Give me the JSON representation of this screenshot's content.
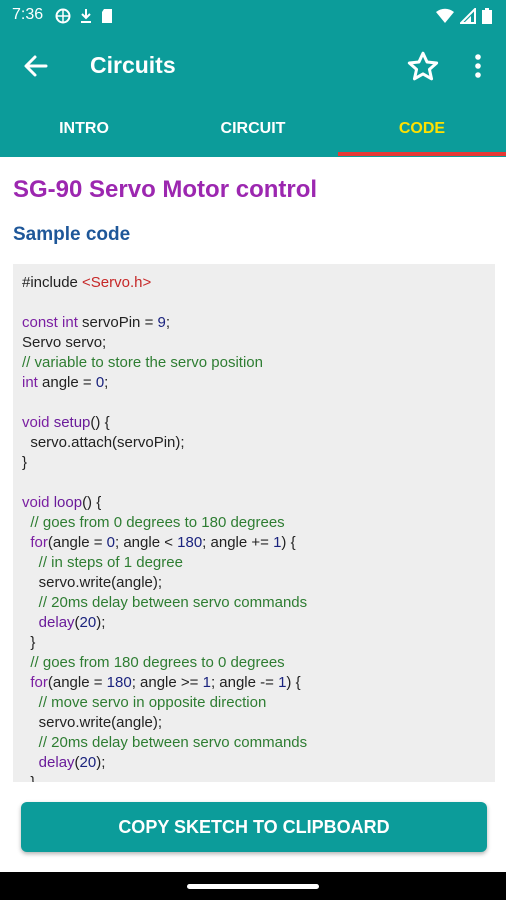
{
  "status_bar": {
    "time": "7:36"
  },
  "app_bar": {
    "title": "Circuits"
  },
  "tabs": [
    {
      "label": "INTRO",
      "active": false
    },
    {
      "label": "CIRCUIT",
      "active": false
    },
    {
      "label": "CODE",
      "active": true
    }
  ],
  "content": {
    "title": "SG-90 Servo Motor control",
    "subtitle": "Sample code",
    "code_lines": [
      "#include <Servo.h>",
      "",
      "const int servoPin = 9;",
      "Servo servo;",
      "// variable to store the servo position",
      "int angle = 0;",
      "",
      "void setup() {",
      "  servo.attach(servoPin);",
      "}",
      "",
      "void loop() {",
      "  // goes from 0 degrees to 180 degrees",
      "  for(angle = 0; angle < 180; angle += 1) {",
      "    // in steps of 1 degree",
      "    servo.write(angle);",
      "    // 20ms delay between servo commands",
      "    delay(20);",
      "  }",
      "  // goes from 180 degrees to 0 degrees",
      "  for(angle = 180; angle >= 1; angle -= 1) {",
      "    // move servo in opposite direction",
      "    servo.write(angle);",
      "    // 20ms delay between servo commands",
      "    delay(20);",
      "  }"
    ]
  },
  "button": {
    "label": "COPY SKETCH TO CLIPBOARD"
  },
  "colors": {
    "primary": "#0c9c9a",
    "tab_active": "#ffe100",
    "indicator": "#e53935",
    "title": "#9c27b0",
    "subtitle": "#1e5799"
  },
  "icons": [
    "arrow-back-icon",
    "star-outline-icon",
    "more-vert-icon",
    "vpn-icon",
    "download-icon",
    "sd-card-icon",
    "wifi-icon",
    "signal-icon",
    "battery-icon"
  ]
}
